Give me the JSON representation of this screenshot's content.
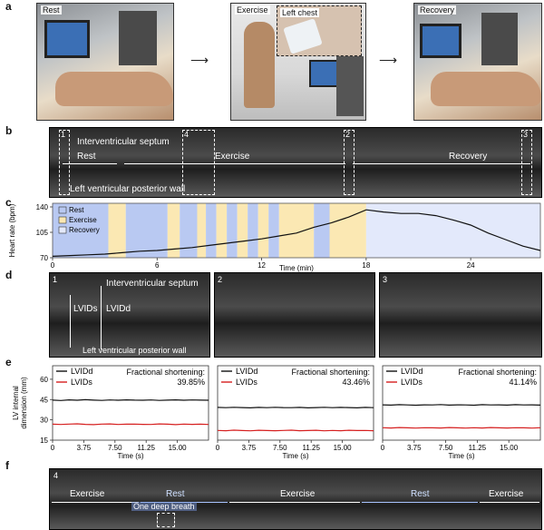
{
  "panel_labels": {
    "a": "a",
    "b": "b",
    "c": "c",
    "d": "d",
    "e": "e",
    "f": "f"
  },
  "panel_a": {
    "rest_title": "Rest",
    "exercise_title": "Exercise",
    "left_chest_label": "Left chest",
    "recovery_title": "Recovery"
  },
  "panel_b": {
    "box_numbers": [
      "1",
      "2",
      "3",
      "4"
    ],
    "septum_label": "Interventricular septum",
    "wall_label": "Left ventricular posterior wall",
    "rest": "Rest",
    "exercise": "Exercise",
    "recovery": "Recovery"
  },
  "panel_c": {
    "legend": [
      "Rest",
      "Exercise",
      "Recovery"
    ],
    "colors": {
      "rest": "#b9c9f2",
      "exercise": "#fbe8b3",
      "recovery": "#e3e9fb",
      "line": "#111111"
    }
  },
  "panel_d": {
    "numbers": [
      "1",
      "2",
      "3"
    ],
    "septum_label": "Interventricular septum",
    "lvids": "LVIDs",
    "lvidd": "LVIDd",
    "wall_label": "Left ventricular posterior wall"
  },
  "panel_f": {
    "number": "4",
    "segments": [
      "Exercise",
      "Rest",
      "Exercise",
      "Rest",
      "Exercise"
    ],
    "deep_breath": "One deep breath"
  },
  "chart_data": [
    {
      "type": "line",
      "xlabel": "Time (min)",
      "ylabel": "Heart rate (bpm)",
      "xlim": [
        0,
        28
      ],
      "ylim": [
        70,
        145
      ],
      "xticks": [
        "0",
        "6",
        "12",
        "18",
        "24"
      ],
      "yticks": [
        "70",
        "105",
        "140"
      ],
      "phases": [
        {
          "kind": "rest",
          "start": 0,
          "end": 3.2
        },
        {
          "kind": "exercise",
          "start": 3.2,
          "end": 4.2
        },
        {
          "kind": "rest",
          "start": 4.2,
          "end": 6.6
        },
        {
          "kind": "exercise",
          "start": 6.6,
          "end": 7.3
        },
        {
          "kind": "rest",
          "start": 7.3,
          "end": 8.3
        },
        {
          "kind": "exercise",
          "start": 8.3,
          "end": 8.8
        },
        {
          "kind": "rest",
          "start": 8.8,
          "end": 9.4
        },
        {
          "kind": "exercise",
          "start": 9.4,
          "end": 10.0
        },
        {
          "kind": "rest",
          "start": 10.0,
          "end": 10.6
        },
        {
          "kind": "exercise",
          "start": 10.6,
          "end": 11.2
        },
        {
          "kind": "rest",
          "start": 11.2,
          "end": 11.8
        },
        {
          "kind": "exercise",
          "start": 11.8,
          "end": 12.4
        },
        {
          "kind": "rest",
          "start": 12.4,
          "end": 13.0
        },
        {
          "kind": "exercise",
          "start": 13.0,
          "end": 15.0
        },
        {
          "kind": "rest",
          "start": 15.0,
          "end": 15.9
        },
        {
          "kind": "exercise",
          "start": 15.9,
          "end": 18.0
        },
        {
          "kind": "recovery",
          "start": 18.0,
          "end": 28.0
        }
      ],
      "x": [
        0,
        1,
        2,
        3,
        4,
        5,
        6,
        7,
        8,
        9,
        10,
        11,
        12,
        13,
        14,
        15,
        16,
        17,
        18,
        19,
        20,
        21,
        22,
        23,
        24,
        25,
        26,
        27,
        28
      ],
      "y": [
        72,
        73,
        74,
        75,
        77,
        79,
        80,
        82,
        84,
        87,
        90,
        93,
        96,
        100,
        104,
        112,
        118,
        126,
        136,
        133,
        131,
        131,
        128,
        122,
        115,
        104,
        95,
        86,
        80
      ]
    },
    {
      "type": "line",
      "xlabel": "Time (s)",
      "ylabel": "LV internal dimension (mm)",
      "xlim": [
        0,
        18.75
      ],
      "ylim": [
        15,
        70
      ],
      "xticks": [
        "0",
        "3.75",
        "7.50",
        "11.25",
        "15.00"
      ],
      "yticks": [
        "15",
        "30",
        "45",
        "60"
      ],
      "annotation": "Fractional shortening:",
      "annotation_value": "39.85%",
      "series": [
        {
          "name": "LVIDd",
          "color": "#111111",
          "values": [
            44.6,
            44.3,
            44.8,
            44.5,
            44.9,
            44.6,
            44.4,
            44.7,
            44.5,
            44.8,
            44.6,
            44.5,
            44.7,
            44.4,
            44.6,
            44.8,
            44.5,
            44.7,
            44.6,
            44.5
          ]
        },
        {
          "name": "LVIDs",
          "color": "#d62020",
          "values": [
            26.8,
            26.6,
            26.9,
            27.1,
            26.7,
            26.5,
            26.9,
            27.0,
            26.6,
            26.8,
            26.9,
            26.7,
            26.6,
            27.0,
            26.8,
            26.5,
            26.9,
            26.7,
            26.8,
            26.6
          ]
        }
      ]
    },
    {
      "type": "line",
      "xlabel": "Time (s)",
      "ylabel": "",
      "xlim": [
        0,
        18.75
      ],
      "ylim": [
        15,
        70
      ],
      "xticks": [
        "0",
        "3.75",
        "7.50",
        "11.25",
        "15.00"
      ],
      "yticks": [],
      "annotation": "Fractional shortening:",
      "annotation_value": "43.46%",
      "series": [
        {
          "name": "LVIDd",
          "color": "#111111",
          "values": [
            39.2,
            39.0,
            39.3,
            39.1,
            38.9,
            39.2,
            39.0,
            39.3,
            39.1,
            39.0,
            39.2,
            38.9,
            39.1,
            39.3,
            39.0,
            39.2,
            39.1,
            38.9,
            39.2,
            39.0
          ]
        },
        {
          "name": "LVIDs",
          "color": "#d62020",
          "values": [
            22.2,
            22.0,
            22.4,
            22.1,
            21.9,
            22.3,
            22.1,
            22.0,
            22.2,
            22.4,
            22.0,
            22.1,
            22.3,
            21.9,
            22.2,
            22.0,
            22.3,
            22.1,
            22.2,
            22.0
          ]
        }
      ]
    },
    {
      "type": "line",
      "xlabel": "Time (s)",
      "ylabel": "",
      "xlim": [
        0,
        18.75
      ],
      "ylim": [
        15,
        70
      ],
      "xticks": [
        "0",
        "3.75",
        "7.50",
        "11.25",
        "15.00"
      ],
      "yticks": [],
      "annotation": "Fractional shortening:",
      "annotation_value": "41.14%",
      "series": [
        {
          "name": "LVIDd",
          "color": "#111111",
          "values": [
            41.1,
            40.9,
            41.2,
            41.0,
            40.8,
            41.1,
            41.0,
            41.3,
            40.9,
            41.1,
            41.0,
            40.8,
            41.2,
            41.0,
            41.1,
            40.9,
            41.2,
            41.0,
            41.1,
            40.9
          ]
        },
        {
          "name": "LVIDs",
          "color": "#d62020",
          "values": [
            24.2,
            24.0,
            24.3,
            24.1,
            23.9,
            24.2,
            24.1,
            24.0,
            24.3,
            24.1,
            23.9,
            24.2,
            24.0,
            24.3,
            24.1,
            24.0,
            24.2,
            24.1,
            23.9,
            24.2
          ]
        }
      ]
    }
  ]
}
